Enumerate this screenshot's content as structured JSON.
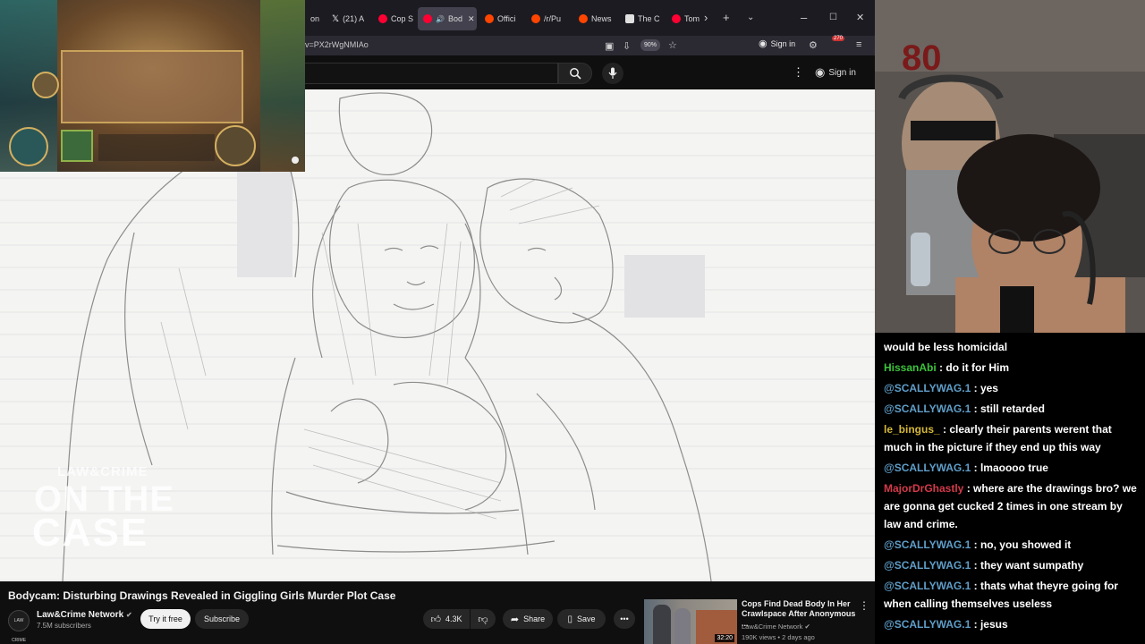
{
  "browser": {
    "tabs": [
      {
        "label": "on",
        "favicon_color": "#e04b4b",
        "active": false
      },
      {
        "label": "(21) A",
        "favicon": "x-icon",
        "active": false
      },
      {
        "label": "Cop S",
        "favicon_color": "#ff0033",
        "active": false
      },
      {
        "label": "Bod",
        "favicon_color": "#ff0033",
        "active": true
      },
      {
        "label": "Offici",
        "favicon_color": "#ff4500",
        "active": false
      },
      {
        "label": "/r/Pu",
        "favicon_color": "#ff4500",
        "active": false
      },
      {
        "label": "News",
        "favicon_color": "#ff4500",
        "active": false
      },
      {
        "label": "The C",
        "favicon_color": "#e0e0e0",
        "active": false
      },
      {
        "label": "Tom",
        "favicon_color": "#ff0033",
        "active": false
      }
    ],
    "url": "v=PX2rWgNMIAo",
    "zoom": "90%",
    "sign_in": "Sign in",
    "badge": "270"
  },
  "youtube": {
    "sign_in": "Sign in",
    "video_title": "Bodycam: Disturbing Drawings Revealed in Giggling Girls Murder Plot Case",
    "channel_name": "Law&Crime Network",
    "channel_avatar_text": "LAW CRIME",
    "subscribers": "7.5M subscribers",
    "try_label": "Try it free",
    "subscribe_label": "Subscribe",
    "likes": "4.3K",
    "share_label": "Share",
    "save_label": "Save",
    "watermark": {
      "line1": "LAW&CRIME",
      "line2": "ON THE",
      "line3": "CASE"
    },
    "recommended": {
      "title": "Cops Find Dead Body In Her Crawlspace After Anonymous ...",
      "channel": "Law&Crime Network",
      "meta": "190K views • 2 days ago",
      "duration": "32:20"
    }
  },
  "chat": [
    {
      "name": "",
      "message": "would be less homicidal",
      "color": "#ffffff"
    },
    {
      "name": "HissanAbi",
      "message": ": do it for Him",
      "color": "#3cc33c"
    },
    {
      "name": "@SCALLYWAG.1",
      "message": ": yes",
      "color": "#5f9ec8"
    },
    {
      "name": "@SCALLYWAG.1",
      "message": ": still retarded",
      "color": "#5f9ec8"
    },
    {
      "name": "le_bingus_",
      "message": ": clearly their parents werent that much in the picture if they end up this way",
      "color": "#d4b83a"
    },
    {
      "name": "@SCALLYWAG.1",
      "message": ": lmaoooo true",
      "color": "#5f9ec8"
    },
    {
      "name": "MajorDrGhastly",
      "message": ": where are the drawings bro? we are gonna get cucked 2 times in one stream by law and crime.",
      "color": "#d43a4a"
    },
    {
      "name": "@SCALLYWAG.1",
      "message": ": no, you showed it",
      "color": "#5f9ec8"
    },
    {
      "name": "@SCALLYWAG.1",
      "message": ": they want sumpathy",
      "color": "#5f9ec8"
    },
    {
      "name": "@SCALLYWAG.1",
      "message": ": thats what theyre going for when calling themselves useless",
      "color": "#5f9ec8"
    },
    {
      "name": "@SCALLYWAG.1",
      "message": ": jesus",
      "color": "#5f9ec8"
    }
  ]
}
